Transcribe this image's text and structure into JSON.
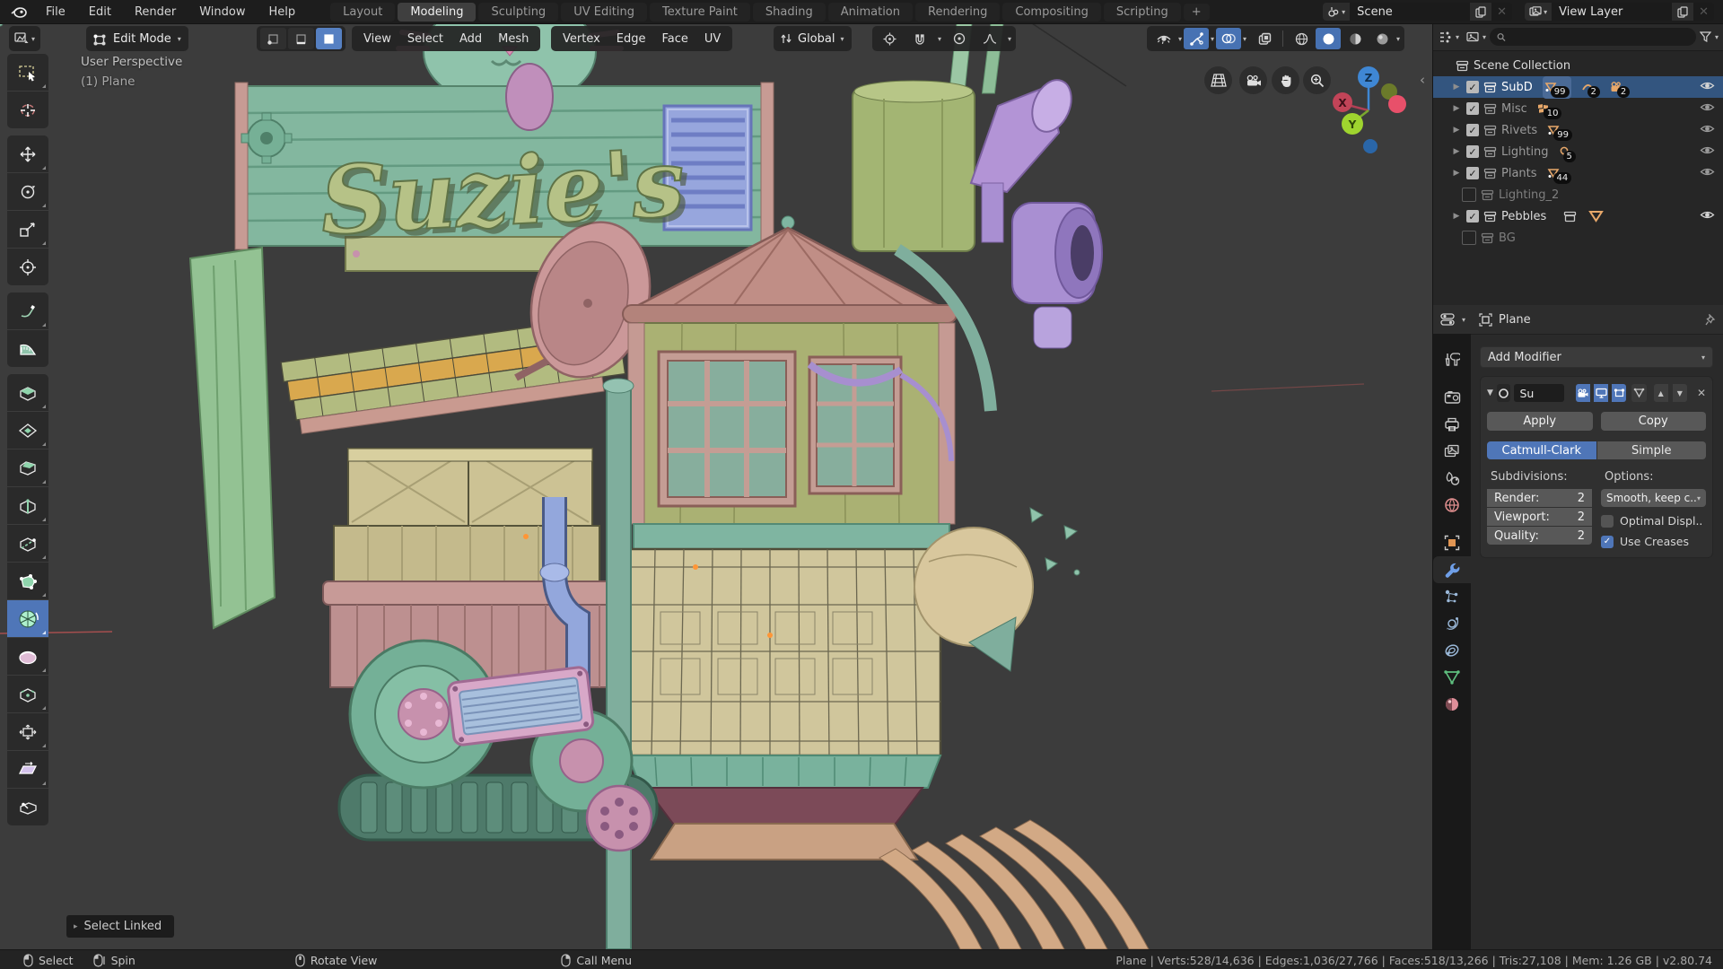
{
  "colors": {
    "accent_blue": "#4f76b8",
    "selected_row_blue": "#33557f",
    "viewport_bg": "#3c3c3c",
    "topbar_bg": "#1d1d1d"
  },
  "topbar": {
    "menus": [
      {
        "label": "File"
      },
      {
        "label": "Edit"
      },
      {
        "label": "Render"
      },
      {
        "label": "Window"
      },
      {
        "label": "Help"
      }
    ],
    "tabs": [
      "Layout",
      "Modeling",
      "Sculpting",
      "UV Editing",
      "Texture Paint",
      "Shading",
      "Animation",
      "Rendering",
      "Compositing",
      "Scripting"
    ],
    "active_tab": "Modeling",
    "new_tab_label": "+",
    "scene_selector": {
      "value": "Scene",
      "clear_label": "✕"
    },
    "view_layer_selector": {
      "value": "View Layer",
      "clear_label": "✕"
    }
  },
  "viewport": {
    "header": {
      "mode": "Edit Mode",
      "menus": [
        "View",
        "Select",
        "Add",
        "Mesh"
      ],
      "element_menus": [
        "Vertex",
        "Edge",
        "Face",
        "UV"
      ],
      "orientation": "Global"
    },
    "overlay": {
      "line1": "User Perspective",
      "line2": "(1) Plane"
    },
    "toast": "Select Linked",
    "model_sign": "Suzie's",
    "gizmo_axes": {
      "x": "X",
      "y": "Y",
      "z": "Z"
    }
  },
  "outliner": {
    "search": {
      "value": "",
      "placeholder": ""
    },
    "scene_collection_label": "Scene Collection",
    "rows": [
      {
        "label": "SubD",
        "badges": [
          {
            "icon": "mesh-data",
            "count": "99"
          },
          {
            "icon": "curve-data",
            "count": "2"
          },
          {
            "icon": "camera-data",
            "count": "2"
          }
        ]
      },
      {
        "label": "Misc",
        "badges": [
          {
            "icon": "image-planes",
            "count": "10"
          }
        ]
      },
      {
        "label": "Rivets",
        "badges": [
          {
            "icon": "mesh-data",
            "count": "99"
          }
        ]
      },
      {
        "label": "Lighting",
        "badges": [
          {
            "icon": "light-data",
            "count": "5"
          }
        ]
      },
      {
        "label": "Plants",
        "badges": [
          {
            "icon": "mesh-data",
            "count": "44"
          }
        ]
      },
      {
        "label": "Lighting_2",
        "badges": []
      },
      {
        "label": "Pebbles",
        "badges": []
      },
      {
        "label": "BG",
        "badges": []
      }
    ]
  },
  "properties": {
    "breadcrumb_object": "Plane",
    "add_modifier_label": "Add Modifier",
    "modifier": {
      "name": "Su",
      "apply_label": "Apply",
      "copy_label": "Copy",
      "algorithm_left": "Catmull-Clark",
      "algorithm_right": "Simple",
      "subdivisions_label": "Subdivisions:",
      "options_label": "Options:",
      "render_label": "Render:",
      "render_value": "2",
      "viewport_label": "Viewport:",
      "viewport_value": "2",
      "quality_label": "Quality:",
      "quality_value": "2",
      "uv_smooth_value": "Smooth, keep c..",
      "optimal_display_label": "Optimal Displ..",
      "use_creases_label": "Use Creases",
      "use_creases_check": "✓"
    }
  },
  "statusbar": {
    "hints": [
      {
        "label": "Select"
      },
      {
        "label": "Spin"
      },
      {
        "label": "Rotate View"
      },
      {
        "label": "Call Menu"
      }
    ],
    "stats": "Plane | Verts:528/14,636 | Edges:1,036/27,766 | Faces:518/13,266 | Tris:27,108 | Mem: 1.26 GB | v2.80.74"
  }
}
